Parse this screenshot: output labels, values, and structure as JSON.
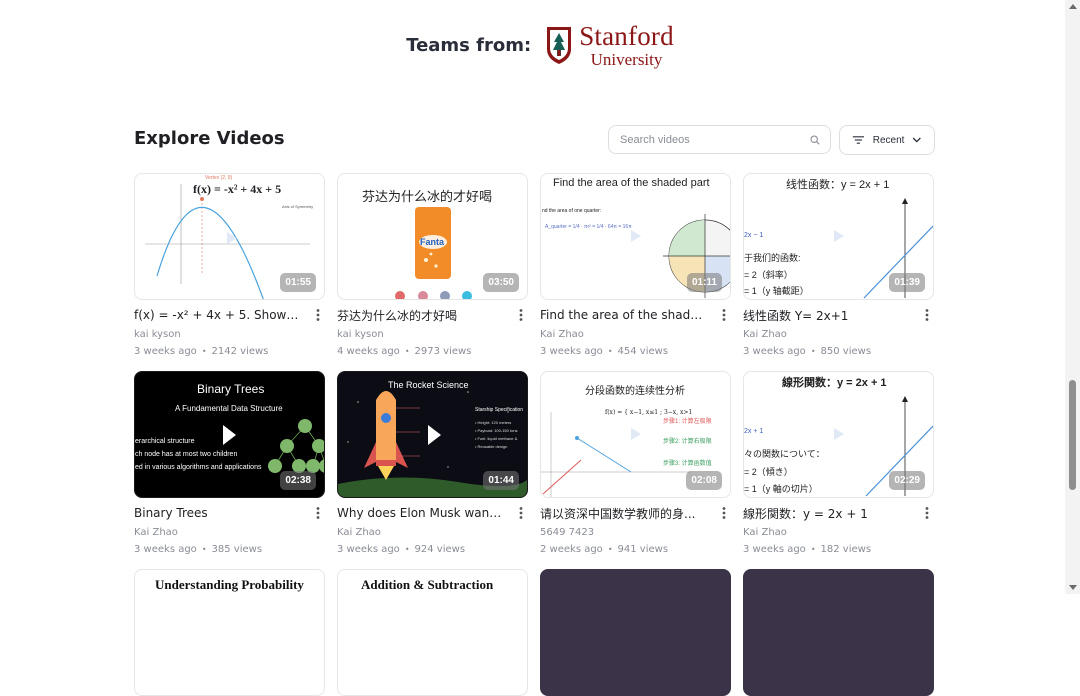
{
  "teams": {
    "label": "Teams from:",
    "logo_name": "Stanford",
    "logo_sub": "University"
  },
  "explore": {
    "title": "Explore Videos",
    "search_placeholder": "Search videos",
    "sort_label": "Recent"
  },
  "videos": [
    {
      "title": "f(x) = -x² + 4x + 5. Show the...",
      "author": "kai kyson",
      "age": "3 weeks ago",
      "views": "2142 views",
      "duration": "01:55",
      "thumb_text": [
        "f(x) = -x² + 4x + 5",
        "Vertex (2, 9)",
        "Axis of Symmetry"
      ]
    },
    {
      "title": "芬达为什么冰的才好喝",
      "author": "kai kyson",
      "age": "4 weeks ago",
      "views": "2973 views",
      "duration": "03:50",
      "thumb_text": [
        "芬达为什么冰的才好喝",
        "Fanta"
      ]
    },
    {
      "title": "Find the area of the shaded ...",
      "author": "Kai Zhao",
      "age": "3 weeks ago",
      "views": "454 views",
      "duration": "01:11",
      "thumb_text": [
        "Find the area of the shaded part",
        "nd the area of one quarter:",
        "A_quarter = 1/4 · πr² = 1/4 · 64π = 16π"
      ]
    },
    {
      "title": "线性函数 Y= 2x+1",
      "author": "Kai Zhao",
      "age": "3 weeks ago",
      "views": "850 views",
      "duration": "01:39",
      "thumb_text": [
        "线性函数：y = 2x + 1",
        "2x − 1",
        "于我们的函数:",
        "= 2（斜率）",
        "= 1（y 轴截距）"
      ]
    },
    {
      "title": "Binary Trees",
      "author": "Kai Zhao",
      "age": "3 weeks ago",
      "views": "385 views",
      "duration": "02:38",
      "thumb_text": [
        "Binary Trees",
        "A Fundamental Data Structure",
        "erarchical structure",
        "ch node has at most two children",
        "ed in various algorithms and applications"
      ]
    },
    {
      "title": "Why does Elon Musk want t...",
      "author": "Kai Zhao",
      "age": "3 weeks ago",
      "views": "924 views",
      "duration": "01:44",
      "thumb_text": [
        "The Rocket Science",
        "Starship Specification",
        "• Height: 120 meters",
        "• Payload: 100-150 tons",
        "• Fuel: liquid methane &",
        "• Reusable design"
      ]
    },
    {
      "title": "请以资深中国数学教师的身...",
      "author": "5649 7423",
      "age": "2 weeks ago",
      "views": "941 views",
      "duration": "02:08",
      "thumb_text": [
        "分段函数的连续性分析",
        "步骤1: 计算左极限",
        "步骤2: 计算右极限",
        "步骤3: 计算函数值"
      ]
    },
    {
      "title": "線形関数：y = 2x + 1",
      "author": "Kai Zhao",
      "age": "3 weeks ago",
      "views": "182 views",
      "duration": "02:29",
      "thumb_text": [
        "線形関数：y = 2x + 1",
        "2x + 1",
        "々の関数について：",
        "= 2（傾き）",
        "= 1（y 軸の切片）"
      ]
    },
    {
      "title": "",
      "author": "",
      "age": "",
      "views": "",
      "duration": "",
      "thumb_text": [
        "Understanding Probability"
      ]
    },
    {
      "title": "",
      "author": "",
      "age": "",
      "views": "",
      "duration": "",
      "thumb_text": [
        "Addition & Subtraction"
      ]
    },
    {
      "title": "",
      "author": "",
      "age": "",
      "views": "",
      "duration": "",
      "thumb_text": []
    },
    {
      "title": "",
      "author": "",
      "age": "",
      "views": "",
      "duration": "",
      "thumb_text": []
    }
  ],
  "colors": {
    "stanford_red": "#8c1515",
    "text": "#1f1f24",
    "muted": "#8a8d96",
    "border": "#dcdee3"
  },
  "icons": [
    "search-icon",
    "filter-lines-icon",
    "chevron-down-icon",
    "kebab-menu-icon",
    "play-icon",
    "stanford-tree-icon"
  ]
}
